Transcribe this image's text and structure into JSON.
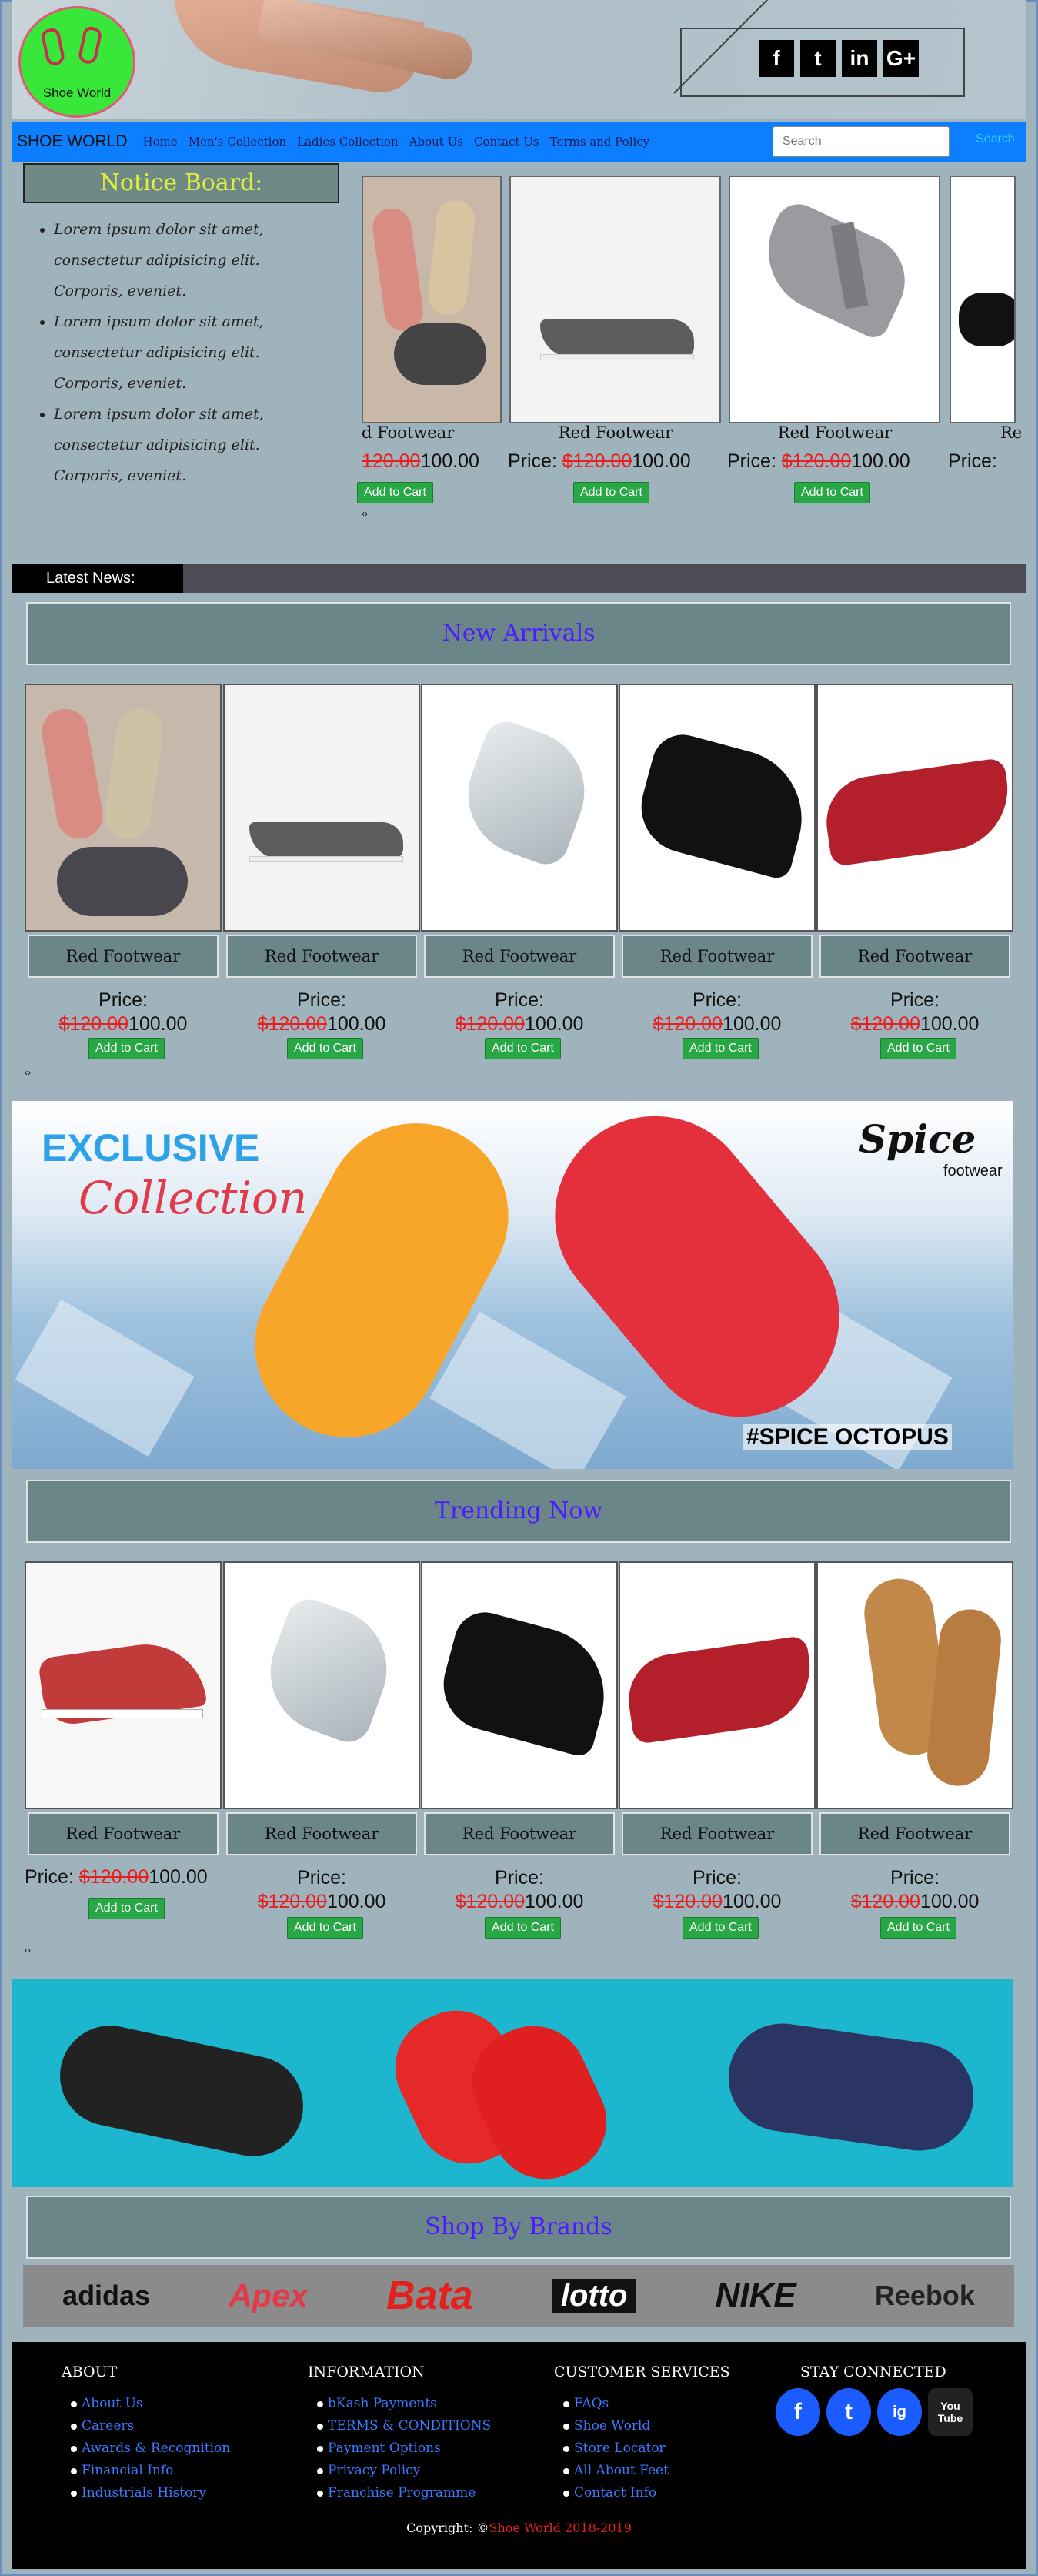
{
  "header": {
    "logo_text": "Shoe World",
    "social": [
      "f",
      "t",
      "in",
      "G+"
    ]
  },
  "nav": {
    "brand": "SHOE WORLD",
    "items": [
      "Home",
      "Men's Collection",
      "Ladies Collection",
      "About Us",
      "Contact Us",
      "Terms and Policy"
    ],
    "search_placeholder": "Search",
    "search_button": "Search"
  },
  "notice": {
    "title": "Notice Board:",
    "items": [
      "Lorem ipsum dolor sit amet, consectetur adipisicing elit. Corporis, eveniet.",
      "Lorem ipsum dolor sit amet, consectetur adipisicing elit. Corporis, eveniet.",
      "Lorem ipsum dolor sit amet, consectetur adipisicing elit. Corporis, eveniet."
    ]
  },
  "carousel": {
    "items": [
      {
        "name": "d Footwear",
        "price_label": "",
        "old": "120.00",
        "new": "100.00",
        "btn": "Add to Cart"
      },
      {
        "name": "Red Footwear",
        "price_label": "Price:",
        "old": "$120.00",
        "new": "100.00",
        "btn": "Add to Cart"
      },
      {
        "name": "Red Footwear",
        "price_label": "Price:",
        "old": "$120.00",
        "new": "100.00",
        "btn": "Add to Cart"
      },
      {
        "name": "Re",
        "price_label": "Price:",
        "old": "",
        "new": "",
        "btn": ""
      }
    ],
    "arrows": "‹›"
  },
  "news": {
    "label": "Latest News:"
  },
  "new_arrivals": {
    "title": "New Arrivals",
    "products": [
      {
        "name": "Red Footwear",
        "price_label": "Price:",
        "old": "$120.00",
        "new": "100.00",
        "btn": "Add to Cart"
      },
      {
        "name": "Red Footwear",
        "price_label": "Price:",
        "old": "$120.00",
        "new": "100.00",
        "btn": "Add to Cart"
      },
      {
        "name": "Red Footwear",
        "price_label": "Price:",
        "old": "$120.00",
        "new": "100.00",
        "btn": "Add to Cart"
      },
      {
        "name": "Red Footwear",
        "price_label": "Price:",
        "old": "$120.00",
        "new": "100.00",
        "btn": "Add to Cart"
      },
      {
        "name": "Red Footwear",
        "price_label": "Price:",
        "old": "$120.00",
        "new": "100.00",
        "btn": "Add to Cart"
      }
    ],
    "arrows": "‹›"
  },
  "banner": {
    "exclusive": "EXCLUSIVE",
    "collection": "Collection",
    "brand": "Spice",
    "brand_sub": "footwear",
    "tag": "#SPICE OCTOPUS"
  },
  "trending": {
    "title": "Trending Now",
    "products": [
      {
        "name": "Red Footwear",
        "price_label": "Price:",
        "old": "$120.00",
        "new": "100.00",
        "btn": "Add to Cart"
      },
      {
        "name": "Red Footwear",
        "price_label": "Price:",
        "old": "$120.00",
        "new": "100.00",
        "btn": "Add to Cart"
      },
      {
        "name": "Red Footwear",
        "price_label": "Price:",
        "old": "$120.00",
        "new": "100.00",
        "btn": "Add to Cart"
      },
      {
        "name": "Red Footwear",
        "price_label": "Price:",
        "old": "$120.00",
        "new": "100.00",
        "btn": "Add to Cart"
      },
      {
        "name": "Red Footwear",
        "price_label": "Price:",
        "old": "$120.00",
        "new": "100.00",
        "btn": "Add to Cart"
      }
    ],
    "arrows": "‹›"
  },
  "brands": {
    "title": "Shop By Brands",
    "items": [
      "adidas",
      "Apex",
      "Bata",
      "lotto",
      "NIKE",
      "Reebok"
    ]
  },
  "footer": {
    "about": {
      "title": "ABOUT",
      "links": [
        "About Us",
        "Careers",
        "Awards & Recognition",
        "Financial Info",
        "Industrials History"
      ]
    },
    "information": {
      "title": "INFORMATION",
      "links": [
        "bKash Payments",
        "TERMS & CONDITIONS",
        "Payment Options",
        "Privacy Policy",
        "Franchise Programme"
      ]
    },
    "customer": {
      "title": "CUSTOMER SERVICES",
      "links": [
        "FAQs",
        "Shoe World",
        "Store Locator",
        "All About Feet",
        "Contact Info"
      ]
    },
    "stay": {
      "title": "STAY CONNECTED",
      "icons": [
        "f",
        "t",
        "ig",
        "You Tube"
      ]
    },
    "copyright_prefix": "Copyright: ©",
    "copyright_brand": "Shoe World",
    "copyright_years": " 2018-2019"
  },
  "colors": {
    "nav": "#0b7fff",
    "section_bg": "#6b8688",
    "section_title": "#4b1cff",
    "price_old": "#e82020",
    "button": "#28a745",
    "notice_title": "#e2ef3a"
  }
}
